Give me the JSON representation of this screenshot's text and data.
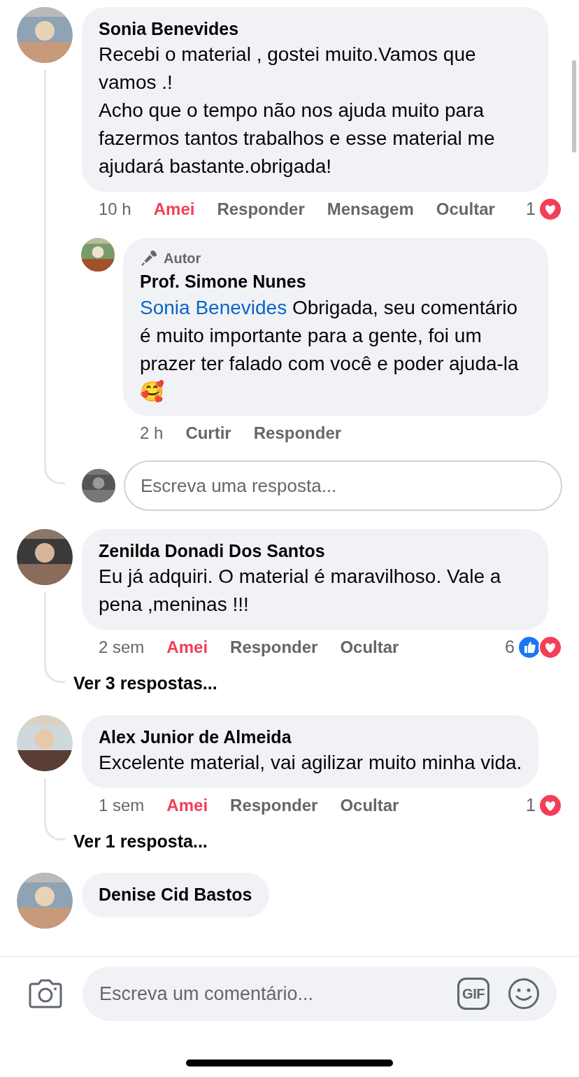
{
  "comments": [
    {
      "name": "Sonia Benevides",
      "text": "Recebi o material , gostei muito.Vamos que vamos .!\nAcho que o tempo não nos ajuda muito para fazermos tantos trabalhos e esse material me ajudará bastante.obrigada!",
      "time": "10 h",
      "reaction": {
        "label": "Amei",
        "reacted": true
      },
      "actions": [
        "Responder",
        "Mensagem",
        "Ocultar"
      ],
      "reaction_count": "1",
      "reaction_icons": [
        {
          "kind": "love"
        }
      ],
      "replies": [
        {
          "badge": "Autor",
          "name": "Prof. Simone Nunes",
          "mention": "Sonia Benevides",
          "text": "Obrigada, seu comentário é muito importante para a gente, foi um prazer ter falado com você e poder ajuda-la🥰",
          "time": "2 h",
          "reaction": {
            "label": "Curtir",
            "reacted": false
          },
          "actions": [
            "Responder"
          ]
        }
      ],
      "reply_field": {
        "placeholder": "Escreva uma resposta..."
      }
    },
    {
      "name": "Zenilda Donadi Dos Santos",
      "text": "Eu já adquiri. O material é maravilhoso. Vale a pena ,meninas !!!",
      "time": "2 sem",
      "reaction": {
        "label": "Amei",
        "reacted": true
      },
      "actions": [
        "Responder",
        "Ocultar"
      ],
      "reaction_count": "6",
      "reaction_icons": [
        {
          "kind": "like"
        },
        {
          "kind": "love"
        }
      ],
      "more_replies": "Ver 3 respostas..."
    },
    {
      "name": "Alex Junior de Almeida",
      "text": "Excelente material, vai agilizar muito minha vida.",
      "time": "1 sem",
      "reaction": {
        "label": "Amei",
        "reacted": true
      },
      "actions": [
        "Responder",
        "Ocultar"
      ],
      "reaction_count": "1",
      "reaction_icons": [
        {
          "kind": "love"
        }
      ],
      "more_replies": "Ver 1 resposta..."
    },
    {
      "name": "Denise Cid Bastos"
    }
  ],
  "composer": {
    "placeholder": "Escreva um comentário...",
    "gif_label": "GIF"
  }
}
